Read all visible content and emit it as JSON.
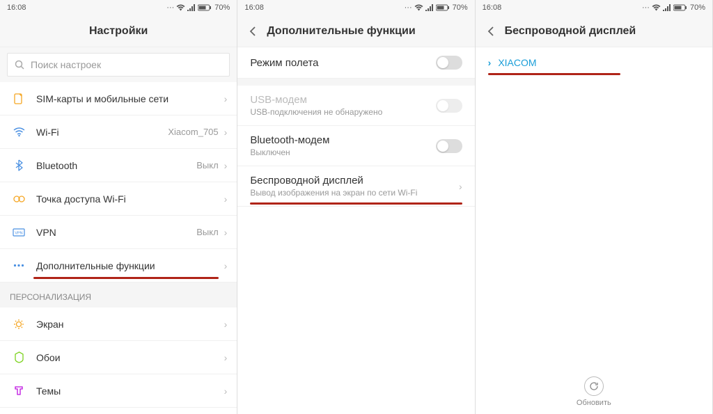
{
  "status": {
    "time": "16:08",
    "battery": "70%"
  },
  "screen1": {
    "title": "Настройки",
    "search_placeholder": "Поиск настроек",
    "rows": [
      {
        "label": "SIM-карты и мобильные сети",
        "value": ""
      },
      {
        "label": "Wi-Fi",
        "value": "Xiacom_705"
      },
      {
        "label": "Bluetooth",
        "value": "Выкл"
      },
      {
        "label": "Точка доступа Wi-Fi",
        "value": ""
      },
      {
        "label": "VPN",
        "value": "Выкл"
      },
      {
        "label": "Дополнительные функции",
        "value": ""
      }
    ],
    "section": "ПЕРСОНАЛИЗАЦИЯ",
    "rows2": [
      {
        "label": "Экран"
      },
      {
        "label": "Обои"
      },
      {
        "label": "Темы"
      }
    ]
  },
  "screen2": {
    "title": "Дополнительные функции",
    "rows": [
      {
        "title": "Режим полета",
        "sub": "",
        "type": "toggle"
      },
      {
        "title": "USB-модем",
        "sub": "USB-подключения не обнаружено",
        "type": "toggle"
      },
      {
        "title": "Bluetooth-модем",
        "sub": "Выключен",
        "type": "toggle"
      },
      {
        "title": "Беспроводной дисплей",
        "sub": "Вывод изображения на экран по сети Wi-Fi",
        "type": "nav"
      }
    ]
  },
  "screen3": {
    "title": "Беспроводной дисплей",
    "device": "XIACOM",
    "refresh": "Обновить"
  }
}
